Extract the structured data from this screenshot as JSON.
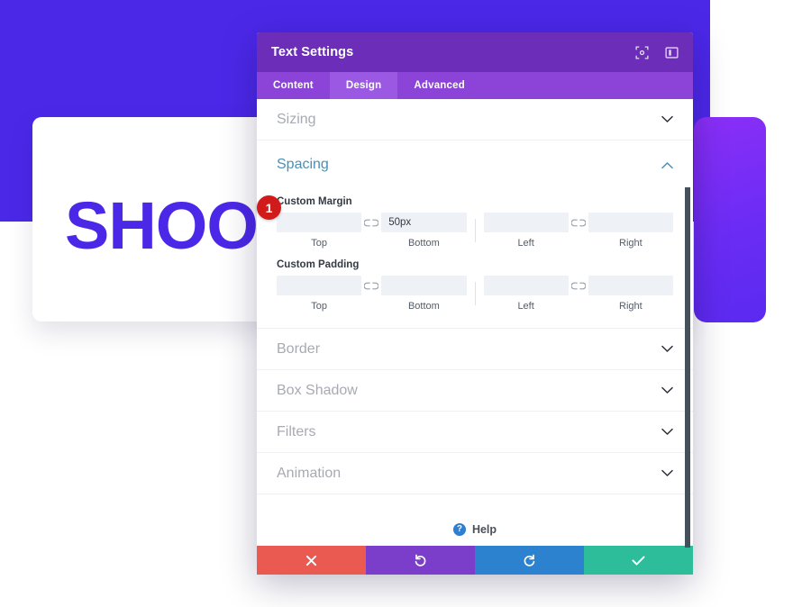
{
  "background": {
    "heading_text": "SHOOT",
    "brand_color": "#4b28e8",
    "accent_card_color": "#6b2cf5"
  },
  "modal": {
    "title": "Text Settings",
    "header_color": "#6c2eb9",
    "header_icons": [
      {
        "name": "expand-icon",
        "label": "Expand"
      },
      {
        "name": "layout-icon",
        "label": "Layout"
      }
    ],
    "tabs": [
      {
        "label": "Content",
        "active": false
      },
      {
        "label": "Design",
        "active": true
      },
      {
        "label": "Advanced",
        "active": false
      }
    ],
    "sections": [
      {
        "label": "Sizing",
        "state": "collapsed"
      },
      {
        "label": "Spacing",
        "state": "expanded"
      },
      {
        "label": "Border",
        "state": "collapsed"
      },
      {
        "label": "Box Shadow",
        "state": "collapsed"
      },
      {
        "label": "Filters",
        "state": "collapsed"
      },
      {
        "label": "Animation",
        "state": "collapsed"
      }
    ],
    "spacing": {
      "custom_margin": {
        "title": "Custom Margin",
        "fields": [
          {
            "label": "Top",
            "value": "",
            "placeholder": ""
          },
          {
            "label": "Bottom",
            "value": "50px",
            "placeholder": ""
          },
          {
            "label": "Left",
            "value": "",
            "placeholder": ""
          },
          {
            "label": "Right",
            "value": "",
            "placeholder": ""
          }
        ]
      },
      "custom_padding": {
        "title": "Custom Padding",
        "fields": [
          {
            "label": "Top",
            "value": "",
            "placeholder": ""
          },
          {
            "label": "Bottom",
            "value": "",
            "placeholder": ""
          },
          {
            "label": "Left",
            "value": "",
            "placeholder": ""
          },
          {
            "label": "Right",
            "value": "",
            "placeholder": ""
          }
        ]
      },
      "link_icon_name": "broken-link-icon"
    },
    "help": {
      "label": "Help",
      "badge": "?"
    },
    "footer_buttons": [
      {
        "name": "cancel-button",
        "icon": "close-icon",
        "color": "#ea5a51"
      },
      {
        "name": "undo-button",
        "icon": "undo-icon",
        "color": "#7a3ecb"
      },
      {
        "name": "redo-button",
        "icon": "redo-icon",
        "color": "#2c82ce"
      },
      {
        "name": "save-button",
        "icon": "check-icon",
        "color": "#2dbd9a"
      }
    ]
  },
  "annotation": {
    "marker_number": "1",
    "marker_color": "#d11a1a"
  }
}
